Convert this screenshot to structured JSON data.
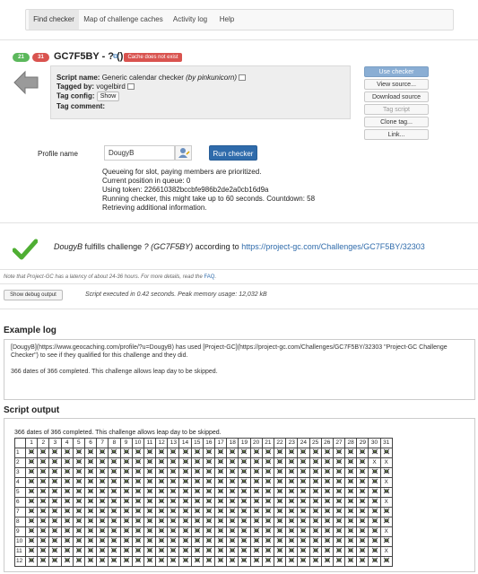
{
  "tabs": [
    {
      "label": "Find checker",
      "active": true
    },
    {
      "label": "Map of challenge caches",
      "active": false
    },
    {
      "label": "Activity log",
      "active": false
    },
    {
      "label": "Help",
      "active": false
    }
  ],
  "header": {
    "badge_ok": "21",
    "badge_fail": "31",
    "title": "GC7F5BY - ? ()",
    "cache_status": "Cache does not exist",
    "script_name_label": "Script name:",
    "script_name": "Generic calendar checker",
    "script_author": "(by pinkunicorn)",
    "tagged_by_label": "Tagged by:",
    "tagged_by": "vogelbird",
    "tag_config_label": "Tag config:",
    "tag_config_button": "Show",
    "tag_comment_label": "Tag comment:",
    "tag_comment": ""
  },
  "actions": [
    {
      "label": "Use checker",
      "style": "primary"
    },
    {
      "label": "View source...",
      "style": "normal"
    },
    {
      "label": "Download source",
      "style": "normal"
    },
    {
      "label": "Tag script",
      "style": "disabled"
    },
    {
      "label": "Clone tag...",
      "style": "normal"
    },
    {
      "label": "Link...",
      "style": "normal"
    }
  ],
  "profile": {
    "label": "Profile name",
    "value": "DougyB",
    "run_button": "Run checker"
  },
  "status_lines": [
    "Queueing for slot, paying members are prioritized.",
    "Current position in queue: 0",
    "Using token: 226610382bccbfe986b2de2a0cb16d9a",
    "Running checker, this might take up to 60 seconds. Countdown: 58",
    "Retrieving additional information."
  ],
  "result": {
    "user": "DougyB",
    "fulfills_text": "fulfills challenge",
    "challenge": "? (GC7F5BY)",
    "according_to": "according to",
    "link": "https://project-gc.com/Challenges/GC7F5BY/32303"
  },
  "latency_note": "Note that Project-GC has a latency of about 24-36 hours. For more details, read the",
  "latency_link": "FAQ",
  "debug_button": "Show debug output",
  "exec_text": "Script executed in 0.42 seconds. Peak memory usage: 12,032 kB",
  "example_log": {
    "heading": "Example log",
    "paragraph1": "[DougyB](https://www.geocaching.com/profile/?u=DougyB) has used [Project-GC](https://project-gc.com/Challenges/GC7F5BY/32303 \"Project-GC Challenge Checker\") to see if they qualified for this challenge and they did.",
    "paragraph2": "366 dates of 366 completed. This challenge allows leap day to be skipped."
  },
  "script_output": {
    "heading": "Script output",
    "summary": "366 dates of 366 completed. This challenge allows leap day to be skipped.",
    "days": [
      "1",
      "2",
      "3",
      "4",
      "5",
      "6",
      "7",
      "8",
      "9",
      "10",
      "11",
      "12",
      "13",
      "14",
      "15",
      "16",
      "17",
      "18",
      "19",
      "20",
      "21",
      "22",
      "23",
      "24",
      "25",
      "26",
      "27",
      "28",
      "29",
      "30",
      "31"
    ],
    "months": [
      "1",
      "2",
      "3",
      "4",
      "5",
      "6",
      "7",
      "8",
      "9",
      "10",
      "11",
      "12"
    ],
    "month_days": [
      31,
      29,
      31,
      30,
      31,
      30,
      31,
      31,
      30,
      31,
      30,
      31
    ],
    "missing_marker": "X"
  }
}
